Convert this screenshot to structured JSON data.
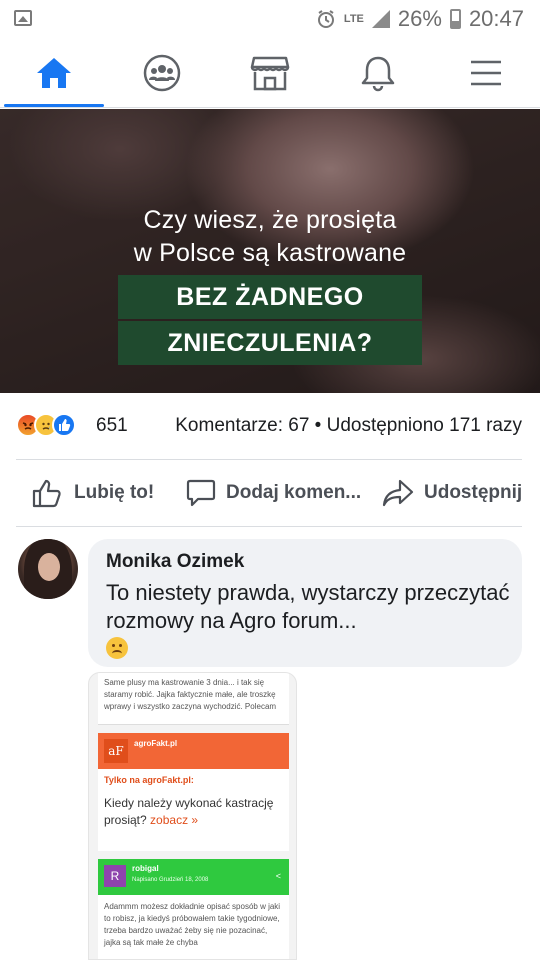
{
  "status_bar": {
    "network": "LTE",
    "battery": "26%",
    "time": "20:47"
  },
  "nav": {
    "items": [
      {
        "icon": "home-icon",
        "active": true
      },
      {
        "icon": "groups-icon",
        "active": false
      },
      {
        "icon": "marketplace-icon",
        "active": false
      },
      {
        "icon": "bell-icon",
        "active": false
      },
      {
        "icon": "menu-icon",
        "active": false
      }
    ]
  },
  "post_image": {
    "line1": "Czy wiesz, że prosięta",
    "line2": "w Polsce są kastrowane",
    "highlight1": "BEZ ŻADNEGO",
    "highlight2": "ZNIECZULENIA?"
  },
  "reactions": {
    "count": "651",
    "stats": "Komentarze: 67 • Udostępniono 171 razy"
  },
  "actions": {
    "like": "Lubię to!",
    "comment": "Dodaj komen...",
    "share": "Udostępnij"
  },
  "comment": {
    "author": "Monika Ozimek",
    "text": "To niestety prawda, wystarczy przeczytać rozmowy na Agro forum..."
  },
  "attachment": {
    "top_text": "Same plusy ma kastrowanie 3 dnia... i tak się staramy robić. Jajka faktycznie małe, ale troszkę wprawy i wszystko zaczyna wychodzić. Polecam",
    "logo": "aF",
    "brand": "agroFakt.pl",
    "heading": "Tylko na agroFakt.pl:",
    "question": "Kiedy należy wykonać kastrację prosiąt?",
    "link": "zobacz »",
    "avatar_letter": "R",
    "user": "robigal",
    "date": "Napisano Grudzień 18, 2008",
    "reply": "Adammm możesz dokładnie opisać sposób w jaki to robisz, ja kiedyś próbowałem takie tygodniowe, trzeba bardzo uważać żeby się nie pozacinać, jajka są tak małe że chyba"
  },
  "colors": {
    "accent": "#1877f2",
    "banner_green": "#1f4a2e",
    "agro_orange": "#f26636",
    "forum_green": "#2fc93f"
  }
}
